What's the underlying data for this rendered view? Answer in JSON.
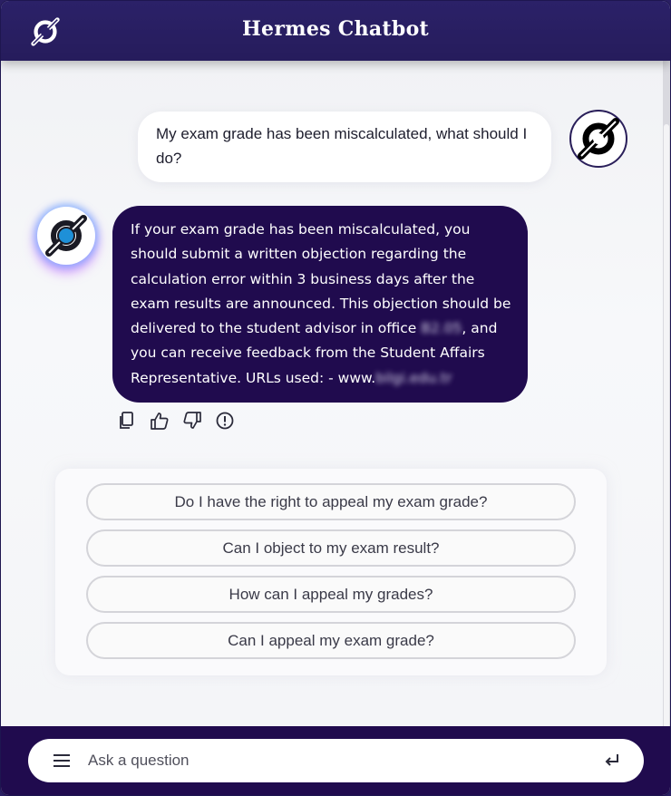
{
  "header": {
    "title": "Hermes Chatbot",
    "logo_icon": "hermes-logo-icon"
  },
  "conversation": {
    "user_message": "My exam grade has been miscalculated, what should I do?",
    "bot_message": {
      "part1": "If your exam grade has been miscalculated, you should submit a written objection regarding the calculation error within 3 business days after the exam results are announced. This objection should be delivered to the student advisor in office",
      "office_redacted": "B2.05",
      "part2": ", and you can receive feedback from the Student Affairs Representative. URLs used: - www.",
      "url_redacted": "bilgi.edu.tr"
    },
    "message_actions": [
      "copy-icon",
      "thumbs-up-icon",
      "thumbs-down-icon",
      "report-icon"
    ]
  },
  "suggestions": [
    "Do I have the right to appeal my exam grade?",
    "Can I object to my exam result?",
    "How can I appeal my grades?",
    "Can I appeal my exam grade?"
  ],
  "input": {
    "placeholder": "Ask a question",
    "menu_icon": "menu-icon",
    "send_icon": "enter-icon"
  },
  "colors": {
    "header_bg": "#2b2168",
    "bot_bubble_bg": "#200b4e",
    "footer_bg": "#200b4e",
    "logo_accent": "#1e90d8"
  }
}
